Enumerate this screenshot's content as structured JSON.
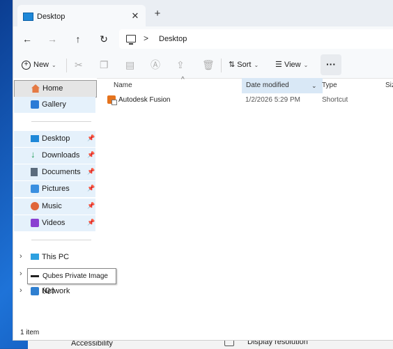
{
  "window": {
    "tab_title": "Desktop",
    "tab_close": "✕",
    "new_tab": "+"
  },
  "nav": {
    "back": "←",
    "forward": "→",
    "up": "↑",
    "refresh": "↻",
    "address_separator": ">",
    "breadcrumb": "Desktop"
  },
  "toolbar": {
    "new_label": "New",
    "sort_label": "Sort",
    "view_label": "View",
    "more_label": "···",
    "icons": [
      "cut-icon",
      "copy-icon",
      "paste-icon",
      "rename-icon",
      "share-icon",
      "delete-icon"
    ]
  },
  "sidebar": {
    "items": [
      {
        "label": "Home",
        "icon": "home-icon",
        "state": "selected"
      },
      {
        "label": "Gallery",
        "icon": "gallery-icon"
      },
      {
        "label": "Desktop",
        "icon": "desktop-icon",
        "pinned": true
      },
      {
        "label": "Downloads",
        "icon": "download-icon",
        "pinned": true
      },
      {
        "label": "Documents",
        "icon": "documents-icon",
        "pinned": true
      },
      {
        "label": "Pictures",
        "icon": "pictures-icon",
        "pinned": true
      },
      {
        "label": "Music",
        "icon": "music-icon",
        "pinned": true
      },
      {
        "label": "Videos",
        "icon": "videos-icon",
        "pinned": true
      },
      {
        "label": "This PC",
        "icon": "pc-icon"
      },
      {
        "label": "Network",
        "icon": "network-icon"
      }
    ]
  },
  "columns": {
    "name": "Name",
    "date_modified": "Date modified",
    "type": "Type",
    "size": "Siz"
  },
  "files": [
    {
      "name": "Autodesk Fusion",
      "date": "1/2/2026 5:29 PM",
      "type": "Shortcut"
    }
  ],
  "tooltip": "Qubes Private Image (Q:)",
  "status": "1 item",
  "background": {
    "accessibility": "Accessibility",
    "display_resolution": "Display resolution"
  },
  "colors": {
    "accent": "#1e88d8",
    "selected_column": "#d9e8f6",
    "pinned_bg": "#e5f1fb"
  }
}
